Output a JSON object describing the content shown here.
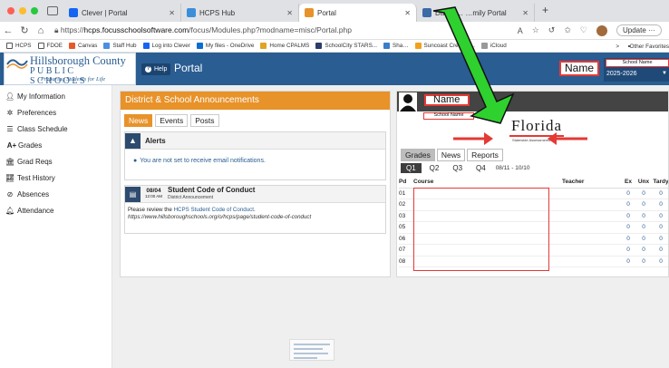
{
  "browser": {
    "tabs": [
      {
        "title": "Clever | Portal",
        "color": "#1464f4"
      },
      {
        "title": "HCPS Hub",
        "color": "#3b8fd8"
      },
      {
        "title": "Portal",
        "color": "#e8922a"
      },
      {
        "title": "Dashb…    …mily Portal",
        "color": "#3b6aa8"
      }
    ],
    "new_tab": "+",
    "url_prefix": "https://",
    "url_host": "hcps.focusschoolsoftware.com",
    "url_path": "/focus/Modules.php?modname=misc/Portal.php",
    "update_label": "Update",
    "more_label": "···"
  },
  "bookmarks": {
    "items": [
      "HCPS",
      "FDOE",
      "Canvas",
      "Staff Hub",
      "Log into Clever",
      "My files - OneDrive",
      "Home CPALMS",
      "SchoolCity STARS...",
      "Sha…",
      "Suncoast Credit U...",
      "iCloud"
    ],
    "other": "Other Favorites",
    "more_chevron": ">"
  },
  "header": {
    "logo_line1": "Hillsborough County",
    "logo_line2": "PUBLIC SCHOOLS",
    "logo_line3": "Preparing Students for Life",
    "help_label": "Help",
    "title": "Portal",
    "user_name": "Name",
    "school_name": "School Name",
    "year": "2025-2026"
  },
  "sidebar": {
    "items": [
      {
        "label": "My Information",
        "icon": "person-icon"
      },
      {
        "label": "Preferences",
        "icon": "gear-icon"
      },
      {
        "label": "Class Schedule",
        "icon": "list-icon"
      },
      {
        "label": "Grades",
        "icon": "grades-icon",
        "prefix": "A+"
      },
      {
        "label": "Grad Reqs",
        "icon": "building-icon"
      },
      {
        "label": "Test History",
        "icon": "chart-icon"
      },
      {
        "label": "Absences",
        "icon": "absence-icon"
      },
      {
        "label": "Attendance",
        "icon": "bell-icon"
      }
    ]
  },
  "announcements": {
    "title": "District & School Announcements",
    "tabs": [
      "News",
      "Events",
      "Posts"
    ],
    "alerts_title": "Alerts",
    "alerts_msg": "You are not set to receive email notifications.",
    "doc_date": "08/04",
    "doc_time": "12:00 AM",
    "doc_title": "Student Code of Conduct",
    "doc_sub": "District Announcement",
    "doc_body_prefix": "Please review the ",
    "doc_link": "HCPS Student Code of Conduct",
    "doc_body_suffix": ".",
    "doc_url": "https://www.hillsboroughschools.org/o/hcps/page/student-code-of-conduct"
  },
  "student": {
    "name": "Name",
    "school": "School Name",
    "fl_logo": "Florida",
    "fl_sub": "Statewide Assessments",
    "tabs": [
      "Grades",
      "News",
      "Reports"
    ],
    "quarters": [
      "Q1",
      "Q2",
      "Q3",
      "Q4"
    ],
    "date_range": "08/11 - 10/10",
    "columns": [
      "Pd",
      "Course",
      "Teacher",
      "Ex",
      "Unx",
      "Tardy"
    ],
    "rows": [
      {
        "pd": "01",
        "ex": "0",
        "unx": "0",
        "tardy": "0"
      },
      {
        "pd": "02",
        "ex": "0",
        "unx": "0",
        "tardy": "0"
      },
      {
        "pd": "03",
        "ex": "0",
        "unx": "0",
        "tardy": "0"
      },
      {
        "pd": "05",
        "ex": "0",
        "unx": "0",
        "tardy": "0"
      },
      {
        "pd": "06",
        "ex": "0",
        "unx": "0",
        "tardy": "0"
      },
      {
        "pd": "07",
        "ex": "0",
        "unx": "0",
        "tardy": "0"
      },
      {
        "pd": "08",
        "ex": "0",
        "unx": "0",
        "tardy": "0"
      }
    ]
  },
  "colors": {
    "header_blue": "#2a5d92",
    "orange": "#e8922a",
    "red_annotation": "#e53935",
    "green_arrow": "#2ed12e"
  }
}
